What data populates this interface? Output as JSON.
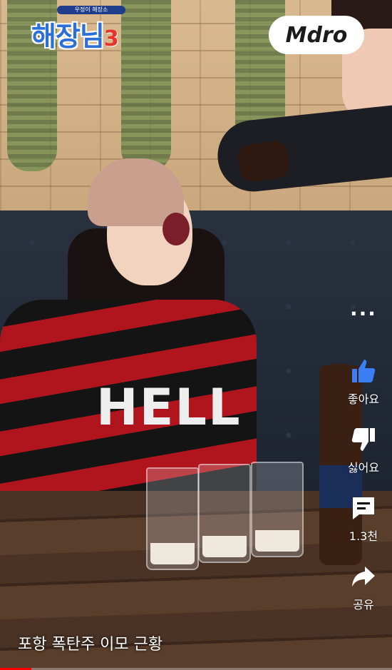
{
  "video": {
    "show_logo": {
      "subtitle": "우정이 해장소",
      "title": "해장님",
      "season": "3"
    },
    "channel_badge": "Mdro",
    "caption": "포항 폭탄주 이모 근황",
    "sweater_text": "HELL"
  },
  "actions": {
    "more_icon": "more-dots-icon",
    "like": {
      "label": "좋아요",
      "icon": "thumb-up-icon",
      "color": "#3a7ff6"
    },
    "dislike": {
      "label": "싫어요",
      "icon": "thumb-down-icon"
    },
    "comments": {
      "label": "1.3천",
      "icon": "comment-icon"
    },
    "share": {
      "label": "공유",
      "icon": "share-icon"
    }
  },
  "progress": 0.08
}
